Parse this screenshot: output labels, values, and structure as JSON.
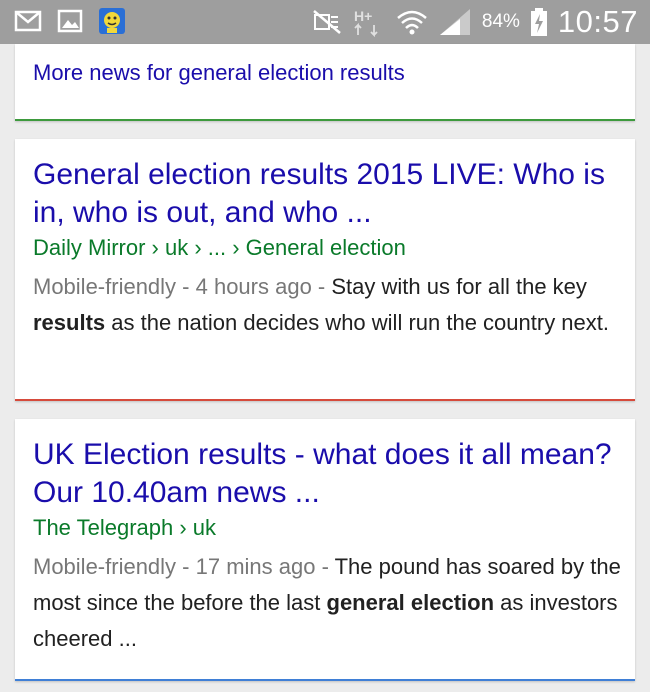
{
  "status_bar": {
    "icons_left": [
      "gmail-icon",
      "gallery-icon",
      "app-icon"
    ],
    "icons_right": [
      "mute-icon",
      "h-plus-data-icon",
      "wifi-icon",
      "signal-icon",
      "battery-charging-icon"
    ],
    "battery": "84%",
    "time": "10:57"
  },
  "results": {
    "more_news_link": "More news for general election results",
    "items": [
      {
        "title": "General election results 2015 LIVE: Who is in, who is out, and who ...",
        "breadcrumb": "Daily Mirror › uk › ... › General election",
        "meta": "Mobile-friendly - 4 hours ago - ",
        "snippet_a": "Stay with us for all the key ",
        "snippet_bold": "results",
        "snippet_b": " as the nation decides who will run the country next.",
        "accent": "#d64a3b"
      },
      {
        "title": "UK Election results - what does it all mean? Our 10.40am news ...",
        "breadcrumb": "The Telegraph › uk",
        "meta": "Mobile-friendly - 17 mins ago - ",
        "snippet_a": "The pound has soared by the most since the before the last ",
        "snippet_bold": "general election",
        "snippet_b": " as investors cheered ...",
        "accent": "#3f7fd6"
      }
    ],
    "top_card_accent": "#3d9a3d"
  },
  "colors": {
    "link": "#1a0dab",
    "url": "#0a7a2a",
    "meta": "#777777",
    "status_bar": "#9e9e9e"
  }
}
